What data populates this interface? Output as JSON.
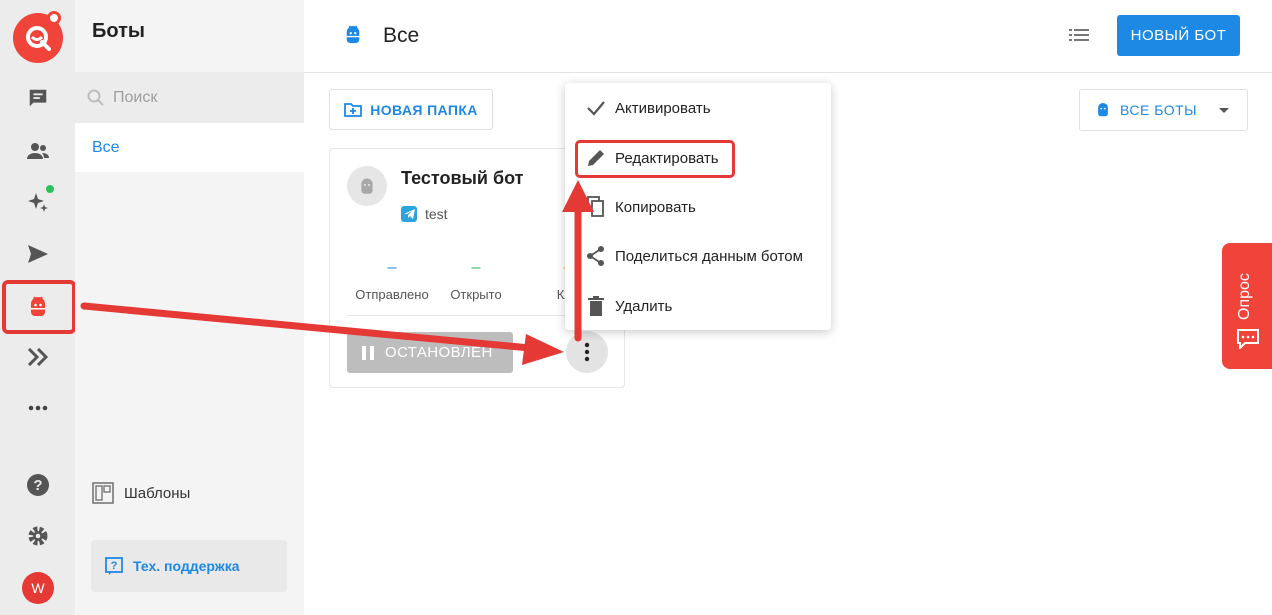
{
  "sidebar": {
    "title": "Боты",
    "search_placeholder": "Поиск",
    "selected_item": "Все",
    "templates_label": "Шаблоны",
    "support_label": "Тех. поддержка"
  },
  "header": {
    "title": "Все",
    "new_bot_label": "НОВЫЙ БОТ"
  },
  "toolbar": {
    "new_folder_label": "НОВАЯ ПАПКА",
    "filter_label": "ВСЕ БОТЫ"
  },
  "bot_card": {
    "name": "Тестовый бот",
    "channel": "test",
    "stats": [
      {
        "label": "Отправлено",
        "value": "–",
        "color": "#1e88e5"
      },
      {
        "label": "Открыто",
        "value": "–",
        "color": "#2ec05b"
      },
      {
        "label": "Кли",
        "value": "–",
        "color": "#f5a623"
      }
    ],
    "status_label": "ОСТАНОВЛЕН"
  },
  "context_menu": {
    "items": [
      {
        "label": "Активировать",
        "icon": "check-icon"
      },
      {
        "label": "Редактировать",
        "icon": "pencil-icon"
      },
      {
        "label": "Копировать",
        "icon": "copy-icon"
      },
      {
        "label": "Поделиться данным ботом",
        "icon": "share-icon"
      },
      {
        "label": "Удалить",
        "icon": "trash-icon"
      }
    ]
  },
  "rail": {
    "avatar_letter": "W"
  },
  "poll_tab": {
    "label": "Опрос"
  },
  "colors": {
    "brand_red": "#f0433a",
    "accent_blue": "#1e88e5",
    "highlight_red": "#e53935"
  }
}
